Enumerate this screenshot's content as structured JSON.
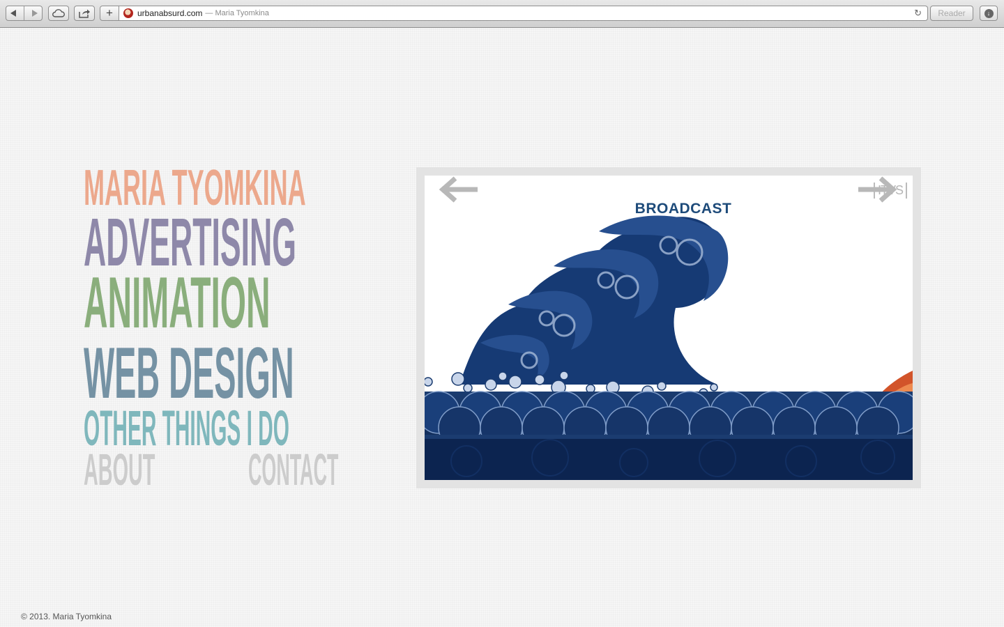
{
  "browser": {
    "url": "urbanabsurd.com",
    "page_title": "— Maria Tyomkina",
    "reader_label": "Reader",
    "plus_label": "+",
    "reload_label": "↻"
  },
  "nav": {
    "name": "MARIA TYOMKINA",
    "advertising": "ADVERTISING",
    "animation": "ANIMATION",
    "web_design": "WEB DESIGN",
    "other": "OTHER THINGS I DO",
    "about": "ABOUT",
    "contact": "CONTACT"
  },
  "slideshow": {
    "heading": "BROADCAST",
    "logo": "ITVS"
  },
  "footer": {
    "copyright": "© 2013. Maria Tyomkina"
  },
  "colors": {
    "name": "#eca88c",
    "advertising": "#8e88a9",
    "animation": "#8aae7c",
    "web_design": "#7592a4",
    "other": "#7fb7bc",
    "about_contact": "#cccccc",
    "wave_dark": "#0f2d5c"
  }
}
